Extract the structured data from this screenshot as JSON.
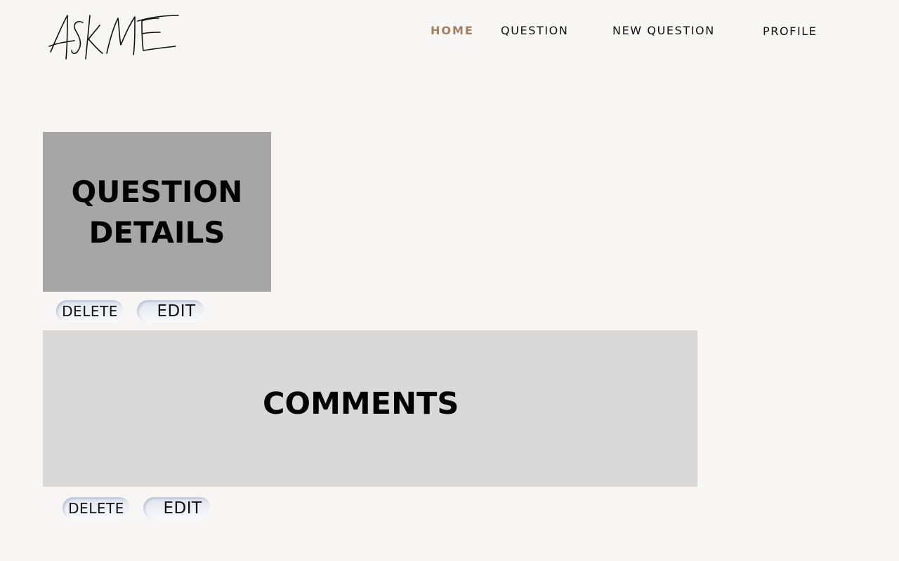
{
  "header": {
    "logo_text": "ASKME",
    "nav": {
      "home": "HOME",
      "question": "QUESTION",
      "new_question": "NEW QUESTION",
      "profile": "PROFILE"
    }
  },
  "question_details": {
    "title_line1": "QUESTION",
    "title_line2": "DETAILS",
    "delete_label": "DELETE",
    "edit_label": "EDIT"
  },
  "comments": {
    "title": "COMMENTS",
    "delete_label": "DELETE",
    "edit_label": "EDIT"
  },
  "colors": {
    "background": "#f7f6f4",
    "nav_active": "#a37f62",
    "question_box": "#a6a6a6",
    "comments_box": "#d9d9d9"
  }
}
